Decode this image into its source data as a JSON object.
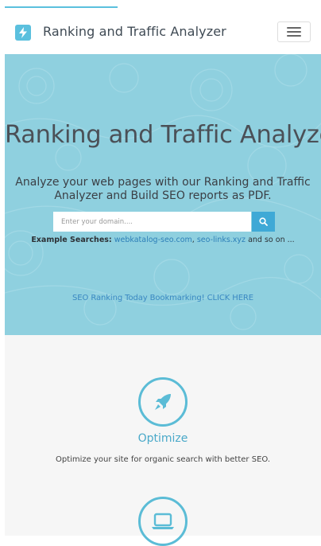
{
  "navbar": {
    "brand": "Ranking and Traffic Analyzer"
  },
  "hero": {
    "title": "Ranking and Traffic Analyzer",
    "subtitle": "Analyze your web pages with our Ranking and Traffic Analyzer and Build SEO reports as PDF.",
    "search_placeholder": "Enter your domain....",
    "examples_label": "Example Searches:",
    "example_1": "webkatalog-seo.com",
    "example_sep": ",",
    "example_2": "seo-links.xyz",
    "examples_tail": "and so on ...",
    "bookmark_link": "SEO Ranking Today Bookmarking! CLICK HERE"
  },
  "features": [
    {
      "title": "Optimize",
      "description": "Optimize your site for organic search with better SEO.",
      "icon": "rocket-icon"
    },
    {
      "title": "",
      "description": "",
      "icon": "laptop-icon"
    }
  ],
  "colors": {
    "accent": "#5bc0de",
    "hero_bg": "#8fd0df",
    "button": "#3fa9d6",
    "link": "#2d7fb8"
  }
}
